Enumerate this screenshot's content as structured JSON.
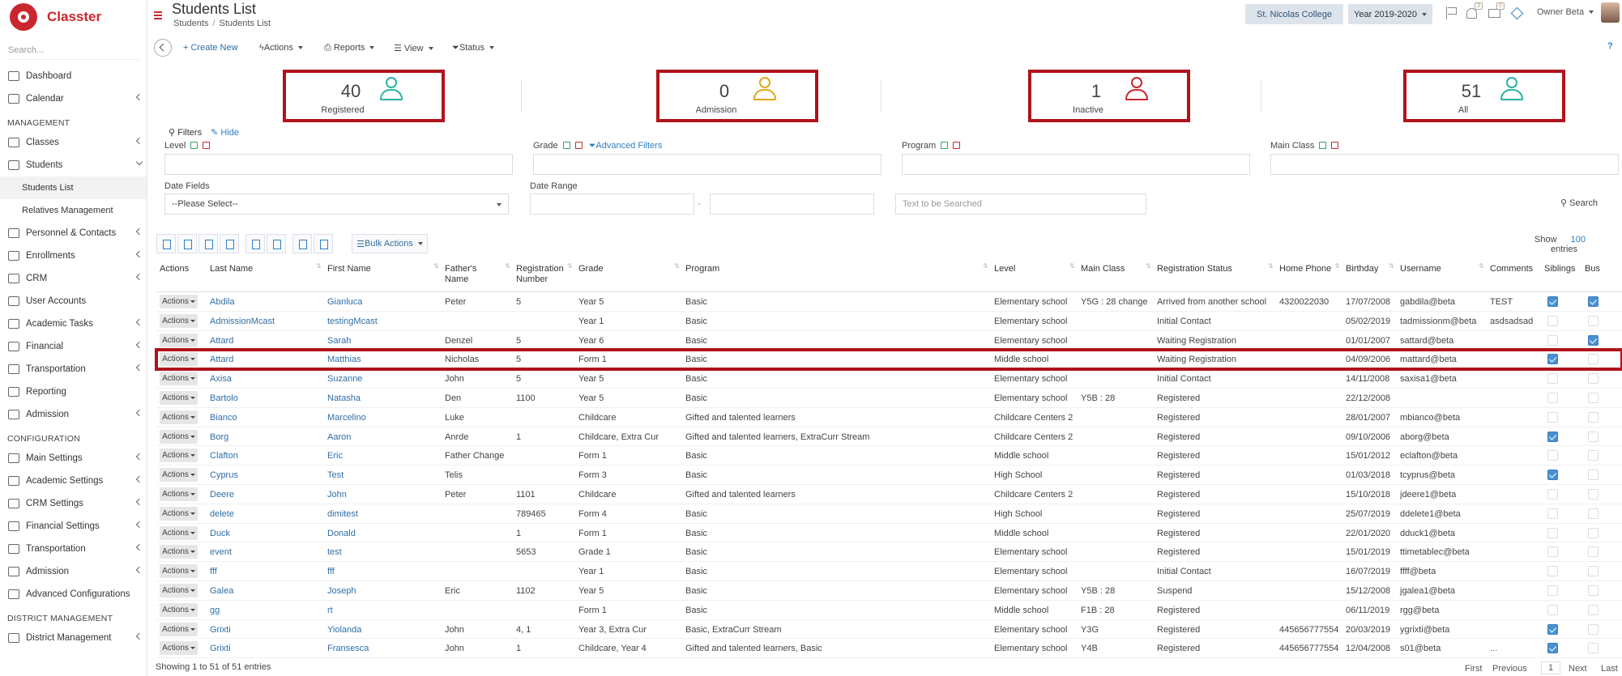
{
  "app": {
    "name": "Classter"
  },
  "sidebar": {
    "search_placeholder": "Search...",
    "items": [
      {
        "label": "Dashboard",
        "icon": "monitor-icon",
        "chev": false
      },
      {
        "label": "Calendar",
        "icon": "calendar-icon",
        "chev": true
      },
      {
        "section": "MANAGEMENT"
      },
      {
        "label": "Classes",
        "icon": "classes-icon",
        "chev": true
      },
      {
        "label": "Students",
        "icon": "students-icon",
        "chev": "down",
        "active": true
      },
      {
        "sub": "Students List",
        "active": true
      },
      {
        "sub": "Relatives Management"
      },
      {
        "label": "Personnel & Contacts",
        "icon": "personnel-icon",
        "chev": true
      },
      {
        "label": "Enrollments",
        "icon": "enrollments-icon",
        "chev": true
      },
      {
        "label": "CRM",
        "icon": "crm-icon",
        "chev": true
      },
      {
        "label": "User Accounts",
        "icon": "key-icon",
        "chev": false
      },
      {
        "label": "Academic Tasks",
        "icon": "tasks-icon",
        "chev": true
      },
      {
        "label": "Financial",
        "icon": "financial-icon",
        "chev": true
      },
      {
        "label": "Transportation",
        "icon": "bus-icon",
        "chev": true
      },
      {
        "label": "Reporting",
        "icon": "reporting-icon",
        "chev": false
      },
      {
        "label": "Admission",
        "icon": "admission-icon",
        "chev": true
      },
      {
        "section": "CONFIGURATION"
      },
      {
        "label": "Main Settings",
        "icon": "sliders-icon",
        "chev": true
      },
      {
        "label": "Academic Settings",
        "icon": "academic-settings-icon",
        "chev": true
      },
      {
        "label": "CRM Settings",
        "icon": "crm-settings-icon",
        "chev": true
      },
      {
        "label": "Financial Settings",
        "icon": "financial-settings-icon",
        "chev": true
      },
      {
        "label": "Transportation",
        "icon": "bus-icon",
        "chev": true
      },
      {
        "label": "Admission",
        "icon": "admission-icon",
        "chev": true
      },
      {
        "label": "Advanced Configurations",
        "icon": "gears-icon",
        "chev": false
      },
      {
        "section": "DISTRICT MANAGEMENT"
      },
      {
        "label": "District Management",
        "icon": "list-icon",
        "chev": true
      }
    ]
  },
  "header": {
    "title": "Students List",
    "breadcrumb": [
      "Students",
      "Students List"
    ],
    "college": "St. Nicolas College",
    "year": "Year 2019-2020",
    "bell_count": "3",
    "mail_count": "0",
    "user": "Owner Beta"
  },
  "toolbar": {
    "create": "+ Create New",
    "actions": "Actions",
    "reports": "Reports",
    "view": "View",
    "status": "Status",
    "help": "?"
  },
  "stats": [
    {
      "value": "40",
      "label": "Registered",
      "color": "#2ab3a6"
    },
    {
      "value": "0",
      "label": "Admission",
      "color": "#e0a71b"
    },
    {
      "value": "1",
      "label": "Inactive",
      "color": "#c9272d"
    },
    {
      "value": "51",
      "label": "All",
      "color": "#2ab3a6"
    }
  ],
  "filters": {
    "title": "Filters",
    "hide": "Hide",
    "level": "Level",
    "grade": "Grade",
    "advanced": "Advanced Filters",
    "program": "Program",
    "main_class": "Main Class",
    "date_fields": "Date Fields",
    "date_fields_value": "--Please Select--",
    "date_range": "Date Range",
    "date_range_sep": "-",
    "text_placeholder": "Text to be Searched",
    "search": "Search"
  },
  "table_tools": {
    "bulk": "Bulk Actions",
    "show": "Show",
    "show_n": "100",
    "entries": "entries"
  },
  "table": {
    "columns": [
      "Actions",
      "Last Name",
      "First Name",
      "Father's Name",
      "Registration Number",
      "Grade",
      "Program",
      "Level",
      "Main Class",
      "Registration Status",
      "Home Phone",
      "Birthday",
      "Username",
      "Comments",
      "Siblings",
      "Bus"
    ],
    "action_label": "Actions",
    "rows": [
      {
        "last": "Abdila",
        "first": "Gianluca",
        "father": "Peter",
        "reg": "5",
        "grade": "Year 5",
        "program": "Basic",
        "level": "Elementary school",
        "main": "Y5G : 28 change",
        "status": "Arrived from another school",
        "phone": "4320022030",
        "birthday": "17/07/2008",
        "user": "gabdila@beta",
        "comments": "TEST",
        "sib": true,
        "bus": true
      },
      {
        "last": "AdmissionMcast",
        "first": "testingMcast",
        "father": "",
        "reg": "",
        "grade": "Year 1",
        "program": "Basic",
        "level": "Elementary school",
        "main": "",
        "status": "Initial Contact",
        "phone": "",
        "birthday": "05/02/2019",
        "user": "tadmissionm@beta",
        "comments": "asdsadsad",
        "sib": false,
        "bus": false
      },
      {
        "last": "Attard",
        "first": "Sarah",
        "father": "Denzel",
        "reg": "5",
        "grade": "Year 6",
        "program": "Basic",
        "level": "Elementary school",
        "main": "",
        "status": "Waiting Registration",
        "phone": "",
        "birthday": "01/01/2007",
        "user": "sattard@beta",
        "comments": "",
        "sib": false,
        "bus": true
      },
      {
        "last": "Attard",
        "first": "Matthias",
        "father": "Nicholas",
        "reg": "5",
        "grade": "Form 1",
        "program": "Basic",
        "level": "Middle school",
        "main": "",
        "status": "Waiting Registration",
        "phone": "",
        "birthday": "04/09/2006",
        "user": "mattard@beta",
        "comments": "",
        "sib": true,
        "bus": false,
        "highlight": true
      },
      {
        "last": "Axisa",
        "first": "Suzanne",
        "father": "John",
        "reg": "5",
        "grade": "Year 5",
        "program": "Basic",
        "level": "Elementary school",
        "main": "",
        "status": "Initial Contact",
        "phone": "",
        "birthday": "14/11/2008",
        "user": "saxisa1@beta",
        "comments": "",
        "sib": false,
        "bus": false
      },
      {
        "last": "Bartolo",
        "first": "Natasha",
        "father": "Den",
        "reg": "1100",
        "grade": "Year 5",
        "program": "Basic",
        "level": "Elementary school",
        "main": "Y5B : 28",
        "status": "Registered",
        "phone": "",
        "birthday": "22/12/2008",
        "user": "",
        "comments": "",
        "sib": false,
        "bus": false
      },
      {
        "last": "Bianco",
        "first": "Marcelino",
        "father": "Luke",
        "reg": "",
        "grade": "Childcare",
        "program": "Gifted and talented learners",
        "level": "Childcare Centers 2",
        "main": "",
        "status": "Registered",
        "phone": "",
        "birthday": "28/01/2007",
        "user": "mbianco@beta",
        "comments": "",
        "sib": false,
        "bus": false
      },
      {
        "last": "Borg",
        "first": "Aaron",
        "father": "Anrde",
        "reg": "1",
        "grade": "Childcare, Extra Cur",
        "program": "Gifted and talented learners, ExtraCurr Stream",
        "level": "Childcare Centers 2",
        "main": "",
        "status": "Registered",
        "phone": "",
        "birthday": "09/10/2006",
        "user": "aborg@beta",
        "comments": "",
        "sib": true,
        "bus": false
      },
      {
        "last": "Clafton",
        "first": "Eric",
        "father": "Father Change",
        "reg": "",
        "grade": "Form 1",
        "program": "Basic",
        "level": "Middle school",
        "main": "",
        "status": "Registered",
        "phone": "",
        "birthday": "15/01/2012",
        "user": "eclafton@beta",
        "comments": "",
        "sib": false,
        "bus": false
      },
      {
        "last": "Cyprus",
        "first": "Test",
        "father": "Telis",
        "reg": "",
        "grade": "Form 3",
        "program": "Basic",
        "level": "High School",
        "main": "",
        "status": "Registered",
        "phone": "",
        "birthday": "01/03/2018",
        "user": "tcyprus@beta",
        "comments": "",
        "sib": true,
        "bus": false
      },
      {
        "last": "Deere",
        "first": "John",
        "father": "Peter",
        "reg": "1101",
        "grade": "Childcare",
        "program": "Gifted and talented learners",
        "level": "Childcare Centers 2",
        "main": "",
        "status": "Registered",
        "phone": "",
        "birthday": "15/10/2018",
        "user": "jdeere1@beta",
        "comments": "",
        "sib": false,
        "bus": false
      },
      {
        "last": "delete",
        "first": "dimitest",
        "father": "",
        "reg": "789465",
        "grade": "Form 4",
        "program": "Basic",
        "level": "High School",
        "main": "",
        "status": "Registered",
        "phone": "",
        "birthday": "25/07/2019",
        "user": "ddelete1@beta",
        "comments": "",
        "sib": false,
        "bus": false
      },
      {
        "last": "Duck",
        "first": "Donald",
        "father": "",
        "reg": "1",
        "grade": "Form 1",
        "program": "Basic",
        "level": "Middle school",
        "main": "",
        "status": "Registered",
        "phone": "",
        "birthday": "22/01/2020",
        "user": "dduck1@beta",
        "comments": "",
        "sib": false,
        "bus": false
      },
      {
        "last": "event",
        "first": "test",
        "father": "",
        "reg": "5653",
        "grade": "Grade 1",
        "program": "Basic",
        "level": "Elementary school",
        "main": "",
        "status": "Registered",
        "phone": "",
        "birthday": "15/01/2019",
        "user": "ttimetablec@beta",
        "comments": "",
        "sib": false,
        "bus": false
      },
      {
        "last": "fff",
        "first": "fff",
        "father": "",
        "reg": "",
        "grade": "Year 1",
        "program": "Basic",
        "level": "Elementary school",
        "main": "",
        "status": "Initial Contact",
        "phone": "",
        "birthday": "16/07/2019",
        "user": "ffff@beta",
        "comments": "",
        "sib": false,
        "bus": false
      },
      {
        "last": "Galea",
        "first": "Joseph",
        "father": "Eric",
        "reg": "1102",
        "grade": "Year 5",
        "program": "Basic",
        "level": "Elementary school",
        "main": "Y5B : 28",
        "status": "Suspend",
        "phone": "",
        "birthday": "15/12/2008",
        "user": "jgalea1@beta",
        "comments": "",
        "sib": false,
        "bus": false
      },
      {
        "last": "gg",
        "first": "rt",
        "father": "",
        "reg": "",
        "grade": "Form 1",
        "program": "Basic",
        "level": "Middle school",
        "main": "F1B : 28",
        "status": "Registered",
        "phone": "",
        "birthday": "06/11/2019",
        "user": "rgg@beta",
        "comments": "",
        "sib": false,
        "bus": false
      },
      {
        "last": "Grixti",
        "first": "Yiolanda",
        "father": "John",
        "reg": "4, 1",
        "grade": "Year 3, Extra Cur",
        "program": "Basic, ExtraCurr Stream",
        "level": "Elementary school",
        "main": "Y3G",
        "status": "Registered",
        "phone": "445656777554",
        "birthday": "20/03/2019",
        "user": "ygrixti@beta",
        "comments": "",
        "sib": true,
        "bus": false
      },
      {
        "last": "Grixti",
        "first": "Fransesca",
        "father": "John",
        "reg": "1",
        "grade": "Childcare, Year 4",
        "program": "Gifted and talented learners, Basic",
        "level": "Elementary school",
        "main": "Y4B",
        "status": "Registered",
        "phone": "445656777554",
        "birthday": "12/04/2008",
        "user": "s01@beta",
        "comments": "...",
        "sib": true,
        "bus": false
      }
    ]
  },
  "footer": {
    "info": "Showing 1 to 51 of 51 entries",
    "first": "First",
    "previous": "Previous",
    "page": "1",
    "next": "Next",
    "last": "Last"
  }
}
